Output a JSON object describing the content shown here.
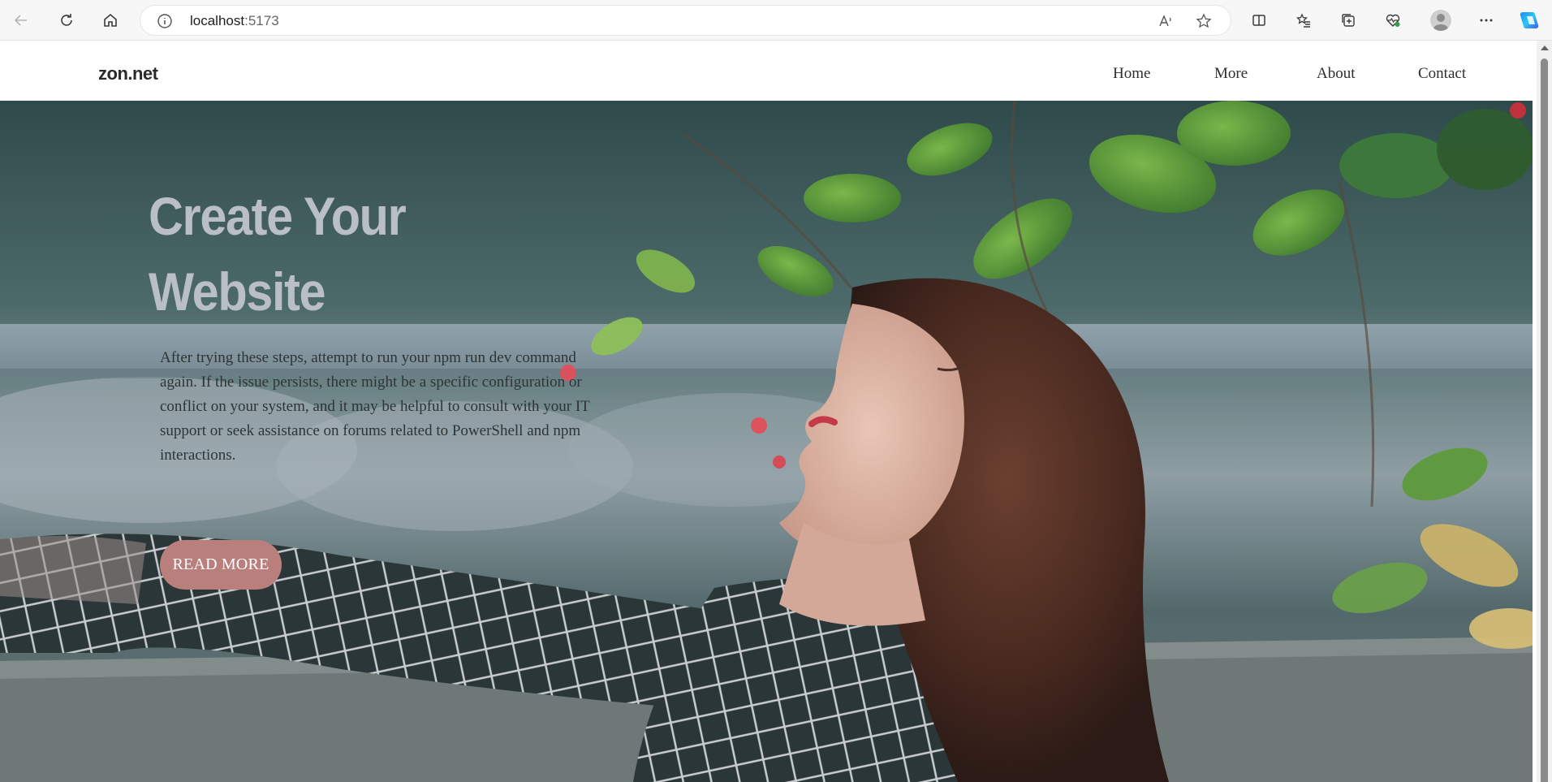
{
  "browser": {
    "url_host": "localhost",
    "url_port": ":5173"
  },
  "site": {
    "logo": "zon.net",
    "nav": [
      {
        "label": "Home"
      },
      {
        "label": "More"
      },
      {
        "label": "About"
      },
      {
        "label": "Contact"
      }
    ]
  },
  "hero": {
    "title_line1": "Create Your",
    "title_line2": "Website",
    "body": "After trying these steps, attempt to run your npm run dev command again. If the issue persists, there might be a specific configuration or conflict on your system, and it may be helpful to consult with your IT support or seek assistance on forums related to PowerShell and npm interactions.",
    "cta_label": "READ MORE"
  },
  "colors": {
    "cta_bg": "#b87f7c",
    "title": "#b9bfc5",
    "body_text": "#2d3436"
  }
}
